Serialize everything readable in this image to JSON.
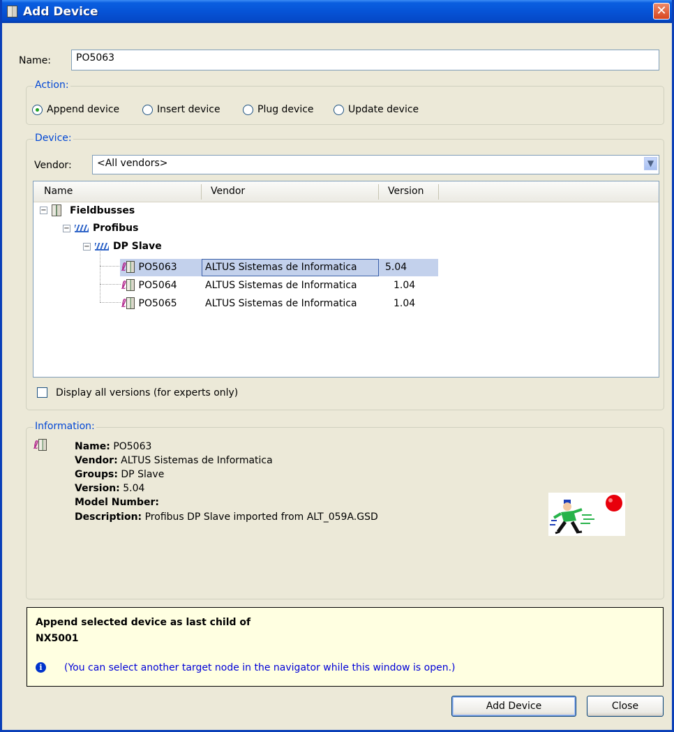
{
  "window": {
    "title": "Add Device",
    "close_glyph": "✕"
  },
  "name_field": {
    "label": "Name:",
    "value": "PO5063"
  },
  "action": {
    "title": "Action:",
    "options": [
      {
        "label": "Append device",
        "checked": true
      },
      {
        "label": "Insert device",
        "checked": false
      },
      {
        "label": "Plug device",
        "checked": false
      },
      {
        "label": "Update device",
        "checked": false
      }
    ]
  },
  "device": {
    "title": "Device:",
    "vendor_label": "Vendor:",
    "vendor_value": "<All vendors>",
    "columns": [
      "Name",
      "Vendor",
      "Version"
    ],
    "tree": {
      "root": "Fieldbusses",
      "bus": "Profibus",
      "group": "DP Slave",
      "rows": [
        {
          "name": "PO5063",
          "vendor": "ALTUS Sistemas de Informatica",
          "version": "5.04",
          "selected": true
        },
        {
          "name": "PO5064",
          "vendor": "ALTUS Sistemas de Informatica",
          "version": "1.04",
          "selected": false
        },
        {
          "name": "PO5065",
          "vendor": "ALTUS Sistemas de Informatica",
          "version": "1.04",
          "selected": false
        }
      ]
    },
    "display_all_versions": {
      "label": "Display all versions (for experts only)",
      "checked": false
    }
  },
  "information": {
    "title": "Information:",
    "name_label": "Name:",
    "name_value": "PO5063",
    "vendor_label": "Vendor:",
    "vendor_value": "ALTUS Sistemas de Informatica",
    "groups_label": "Groups:",
    "groups_value": "DP Slave",
    "version_label": "Version:",
    "version_value": "5.04",
    "model_label": "Model Number:",
    "model_value": "",
    "description_label": "Description:",
    "description_value": "Profibus DP Slave imported from ALT_059A.GSD"
  },
  "hint": {
    "line1": "Append selected device as last child of",
    "line2": "NX5001",
    "note": "(You can select another target node in the navigator while this window is open.)",
    "info_glyph": "i"
  },
  "buttons": {
    "add_device": "Add Device",
    "close": "Close"
  },
  "colors": {
    "title_bar": "#0653d6",
    "accent_blue": "#0046d5",
    "hint_background": "#ffffe1",
    "selection": "#c3d1ec"
  }
}
